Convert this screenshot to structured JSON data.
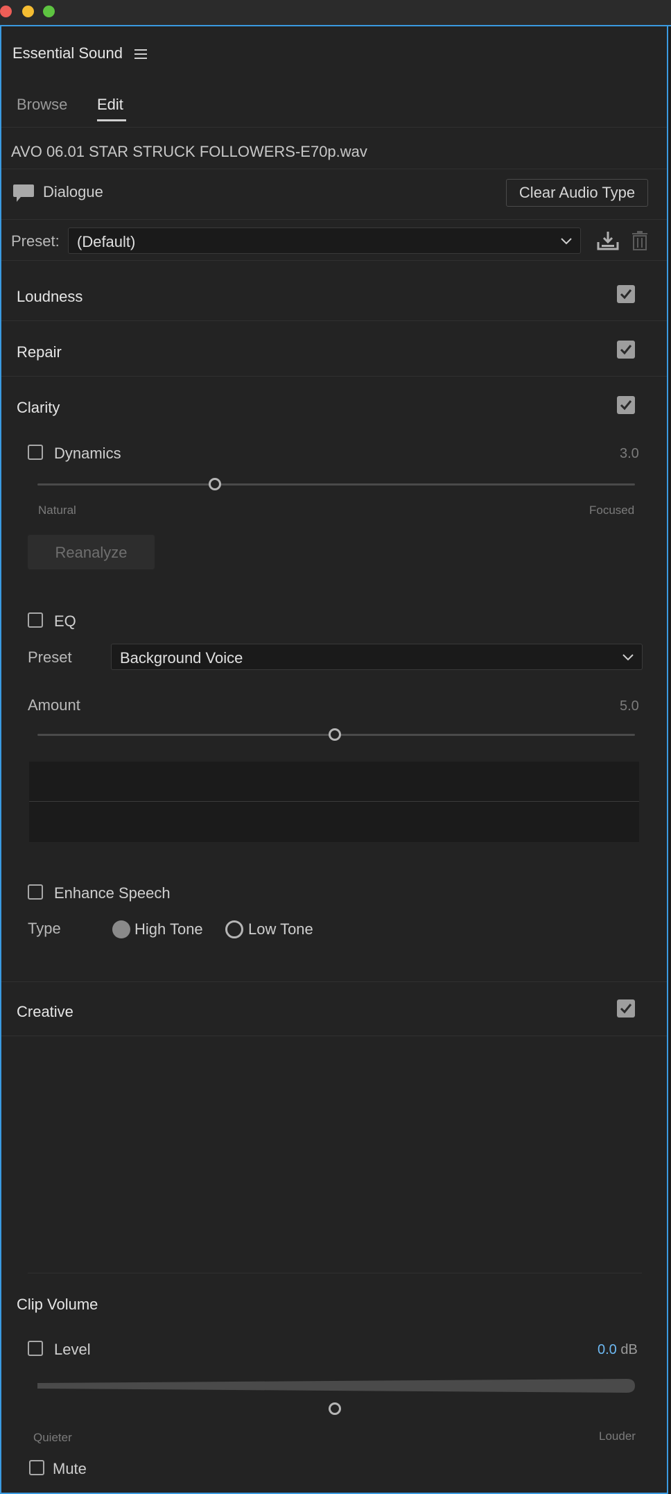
{
  "panel": {
    "title": "Essential Sound",
    "tabs": [
      {
        "label": "Browse"
      },
      {
        "label": "Edit"
      }
    ],
    "file_name": "AVO 06.01  STAR STRUCK FOLLOWERS-E70p.wav",
    "audio_type": "Dialogue",
    "clear_audio_type_label": "Clear Audio Type",
    "preset": {
      "label": "Preset:",
      "value": "(Default)"
    }
  },
  "sections": {
    "loudness": {
      "label": "Loudness",
      "enabled": true
    },
    "repair": {
      "label": "Repair",
      "enabled": true
    },
    "clarity": {
      "label": "Clarity",
      "enabled": true
    },
    "creative": {
      "label": "Creative",
      "enabled": true
    }
  },
  "clarity": {
    "dynamics": {
      "label": "Dynamics",
      "checked": false,
      "value": "3.0",
      "level": 3.0,
      "min_label": "Natural",
      "max_label": "Focused",
      "reanalyze_label": "Reanalyze"
    },
    "eq": {
      "label": "EQ",
      "checked": false,
      "preset_label": "Preset",
      "preset_value": "Background Voice",
      "amount_label": "Amount",
      "amount_value": "5.0",
      "level": 5.0
    },
    "enhance_speech": {
      "label": "Enhance Speech",
      "checked": false,
      "type_label": "Type",
      "options": [
        {
          "label": "High Tone",
          "selected": true
        },
        {
          "label": "Low Tone",
          "selected": false
        }
      ]
    }
  },
  "clip_volume": {
    "label": "Clip Volume",
    "level": {
      "label": "Level",
      "checked": false,
      "value": "0.0",
      "unit": "dB",
      "min_label": "Quieter",
      "max_label": "Louder"
    },
    "mute": {
      "label": "Mute",
      "checked": false
    }
  },
  "colors": {
    "accent": "#3a9ae0",
    "value_blue": "#6db8f2",
    "panel_bg": "#232323"
  }
}
